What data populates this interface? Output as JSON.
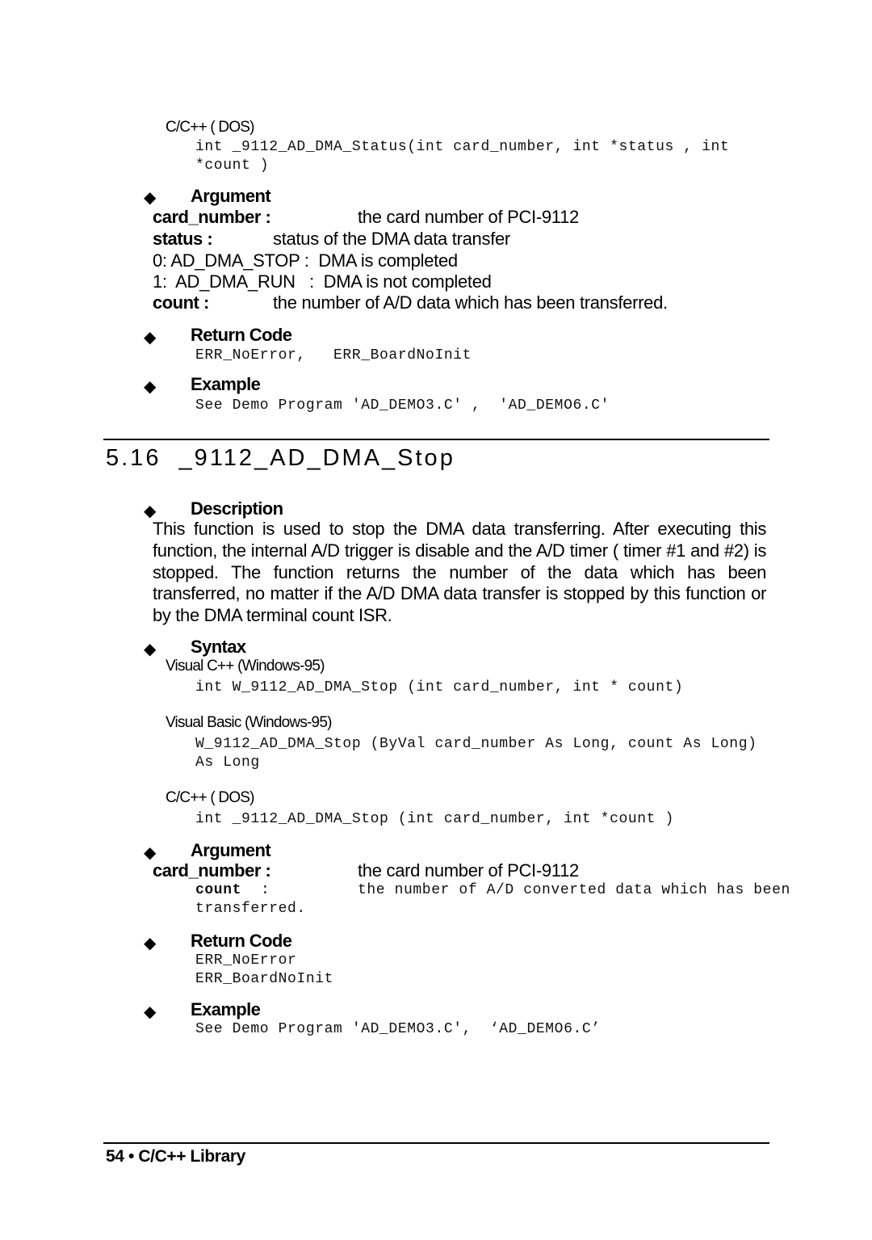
{
  "top": {
    "dos_label": "C/C++ ( DOS)",
    "dos_code_line1": "int _9112_AD_DMA_Status(int card_number, int *status , int",
    "dos_code_line2": "*count )",
    "argument": {
      "heading": "Argument",
      "card_number_label": "card_number :",
      "card_number_desc": "the card number of PCI-9112",
      "status_label": "status :",
      "status_desc": "status of the DMA data transfer",
      "status_values": [
        "0: AD_DMA_STOP :  DMA is completed",
        "1:  AD_DMA_RUN   :  DMA is not completed"
      ],
      "count_label": "count :",
      "count_desc": "the number of A/D data which has been transferred."
    },
    "return_code": {
      "heading": "Return Code",
      "line": "ERR_NoError,   ERR_BoardNoInit"
    },
    "example": {
      "heading": "Example",
      "line": "See Demo Program 'AD_DEMO3.C' ,  'AD_DEMO6.C'"
    }
  },
  "section": {
    "title": "5.16  _9112_AD_DMA_Stop",
    "description": {
      "heading": "Description",
      "text": "This function is used to stop the DMA data transferring.  After executing this function, the internal A/D trigger is disable and the A/D timer ( timer #1 and #2) is stopped.  The function returns the number of the data which has been transferred, no matter if the A/D DMA data transfer is stopped by this function or by the DMA terminal count ISR."
    },
    "syntax": {
      "heading": "Syntax",
      "vc_label": "Visual C++ (Windows-95)",
      "vc_code": "int W_9112_AD_DMA_Stop (int card_number, int * count)",
      "vb_label": "Visual Basic (Windows-95)",
      "vb_code_line1": "W_9112_AD_DMA_Stop (ByVal card_number As Long, count As Long)",
      "vb_code_line2": "As Long",
      "dos_label": "C/C++ ( DOS)",
      "dos_code": "int _9112_AD_DMA_Stop (int card_number, int *count )"
    },
    "argument": {
      "heading": "Argument",
      "card_number_label": "card_number :",
      "card_number_desc": "the card number of PCI-9112",
      "count_label": "count",
      "count_colon": ":",
      "count_desc": "the number of A/D converted data which has been",
      "count_desc_cont": "transferred."
    },
    "return_code": {
      "heading": "Return Code",
      "lines": [
        "ERR_NoError",
        "ERR_BoardNoInit"
      ]
    },
    "example": {
      "heading": "Example",
      "line": "See Demo Program 'AD_DEMO3.C',  ‘AD_DEMO6.C’"
    }
  },
  "footer": {
    "page_number": "54",
    "separator": "•",
    "title": "C/C++ Library"
  },
  "icons": {
    "bullet": "◆"
  }
}
